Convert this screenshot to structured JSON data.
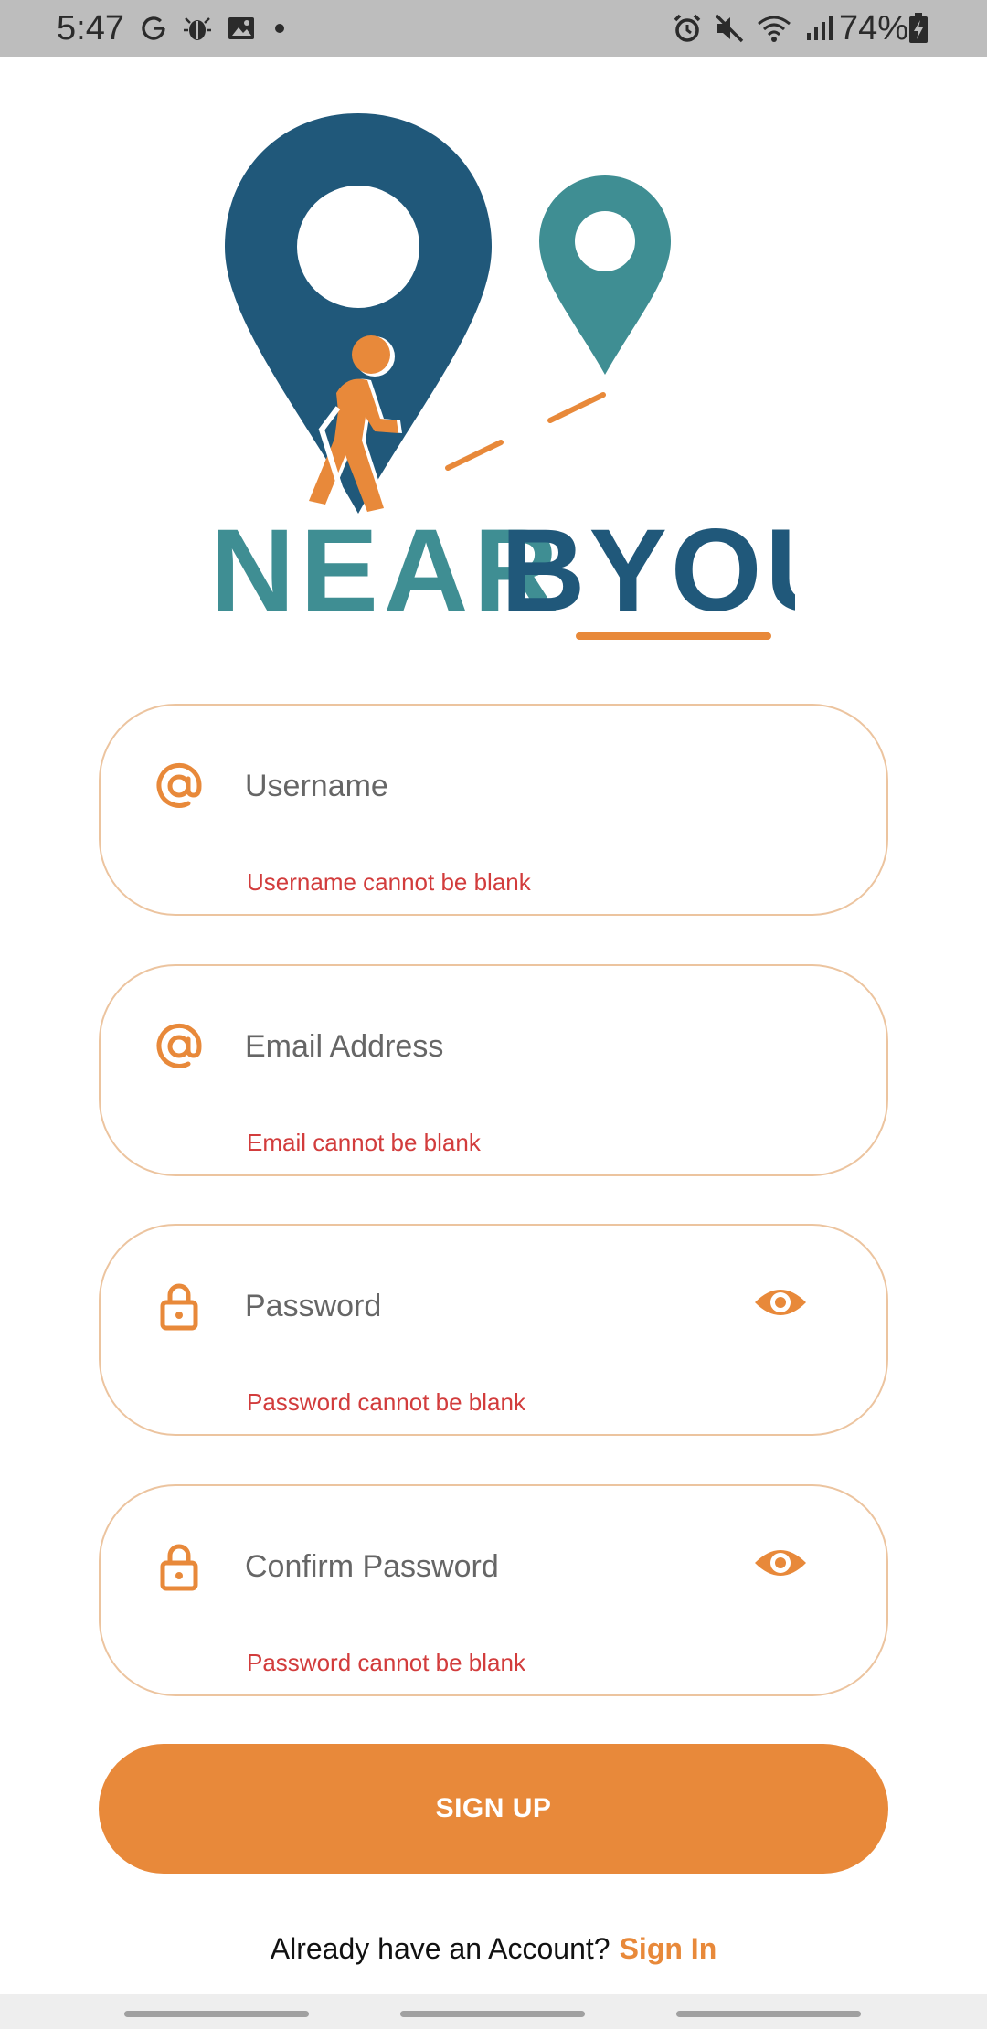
{
  "status_bar": {
    "time": "5:47",
    "battery": "74%",
    "left_icons": [
      "google-icon",
      "bug-icon",
      "image-icon",
      "dot-icon"
    ],
    "right_icons": [
      "alarm-icon",
      "mute-icon",
      "wifi-icon",
      "signal-icon",
      "battery-icon"
    ]
  },
  "logo": {
    "word_part1": "NEAR",
    "word_part2": "BYOU",
    "colors": {
      "navy": "#20587a",
      "teal": "#3f8e93",
      "orange": "#e8893a"
    }
  },
  "form": {
    "username": {
      "placeholder": "Username",
      "value": "",
      "error": "Username cannot be blank",
      "icon": "at-icon"
    },
    "email": {
      "placeholder": "Email Address",
      "value": "",
      "error": "Email cannot be blank",
      "icon": "at-icon"
    },
    "password": {
      "placeholder": "Password",
      "value": "",
      "error": "Password cannot be blank",
      "icon": "lock-icon",
      "toggle_icon": "eye-icon"
    },
    "confirm_password": {
      "placeholder": "Confirm Password",
      "value": "",
      "error": "Password cannot be blank",
      "icon": "lock-icon",
      "toggle_icon": "eye-icon"
    }
  },
  "signup_button": {
    "label": "SIGN UP",
    "color": "#e8893a"
  },
  "footer": {
    "prompt": "Already have an Account?",
    "link": "Sign In"
  },
  "colors": {
    "accent": "#e8893a",
    "field_border": "#ecc49f",
    "error": "#d23c3c"
  }
}
